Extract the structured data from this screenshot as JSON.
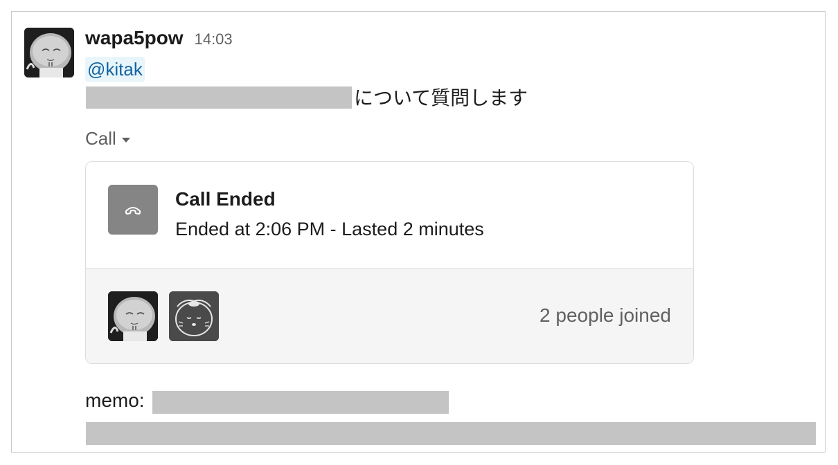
{
  "message": {
    "author": "wapa5pow",
    "timestamp": "14:03",
    "mention": "@kitak",
    "line2_suffix": "について質問します",
    "memo_label": "memo:"
  },
  "call": {
    "dropdown_label": "Call",
    "status_title": "Call Ended",
    "status_detail": "Ended at 2:06 PM - Lasted 2 minutes",
    "participants_text": "2 people joined",
    "participant_count": 2
  },
  "icons": {
    "caret": "chevron-down-icon",
    "phone": "phone-hangup-icon"
  },
  "colors": {
    "mention_text": "#1264a3",
    "mention_bg": "#e8f5fa",
    "phone_tile": "#858585",
    "redaction": "#c4c4c4",
    "card_footer": "#f5f5f5"
  }
}
